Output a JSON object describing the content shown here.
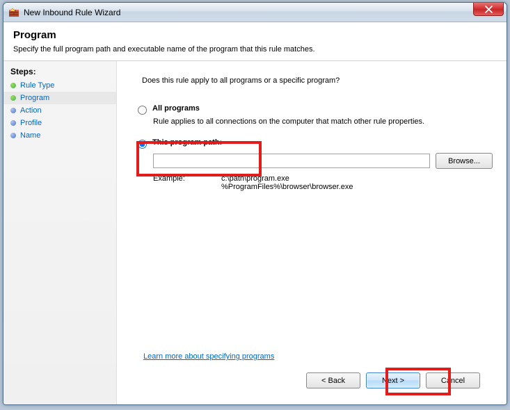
{
  "window": {
    "title": "New Inbound Rule Wizard"
  },
  "header": {
    "heading": "Program",
    "subtitle": "Specify the full program path and executable name of the program that this rule matches."
  },
  "sidebar": {
    "steps_label": "Steps:",
    "items": [
      {
        "label": "Rule Type",
        "state": "done"
      },
      {
        "label": "Program",
        "state": "done",
        "active": true
      },
      {
        "label": "Action",
        "state": "pending"
      },
      {
        "label": "Profile",
        "state": "pending"
      },
      {
        "label": "Name",
        "state": "pending"
      }
    ]
  },
  "content": {
    "question": "Does this rule apply to all programs or a specific program?",
    "option_all": {
      "label": "All programs",
      "desc": "Rule applies to all connections on the computer that match other rule properties."
    },
    "option_path": {
      "label": "This program path:",
      "value": "",
      "browse_label": "Browse...",
      "example_label": "Example:",
      "example_line1": "c:\\path\\program.exe",
      "example_line2": "%ProgramFiles%\\browser\\browser.exe"
    },
    "learn_link": "Learn more about specifying programs"
  },
  "footer": {
    "back": "< Back",
    "next": "Next >",
    "cancel": "Cancel"
  }
}
